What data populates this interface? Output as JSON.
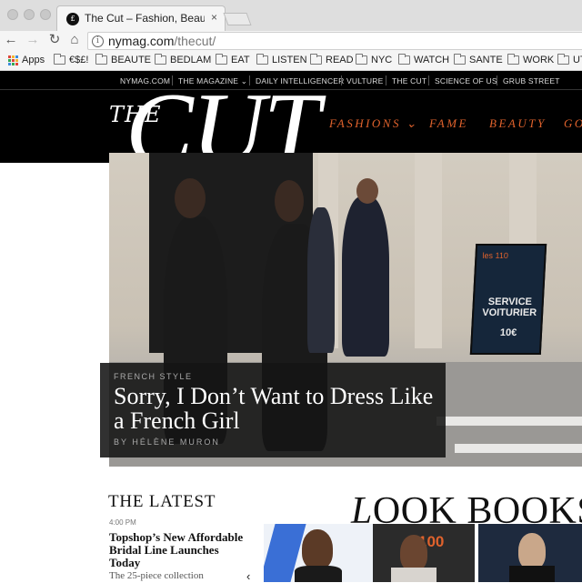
{
  "browser": {
    "tab_title": "The Cut – Fashion, Beauty, Politics",
    "tab_favicon": "£",
    "url_host": "nymag.com",
    "url_path": "/thecut/",
    "close_icon": "×"
  },
  "bookmarks": [
    "Apps",
    "€$£!",
    "BEAUTE",
    "BEDLAM",
    "EAT",
    "LISTEN",
    "READ",
    "NYC",
    "WATCH",
    "SANTE",
    "WORK",
    "UT"
  ],
  "site_nav": [
    "NYMAG.COM",
    "THE MAGAZINE ⌄",
    "DAILY INTELLIGENCER",
    "VULTURE",
    "THE CUT",
    "SCIENCE OF US",
    "GRUB STREET"
  ],
  "logo": {
    "the": "THE",
    "cut": "CUT"
  },
  "sections": [
    "FASHIONS ⌄",
    "FAME",
    "BEAUTY",
    "GO"
  ],
  "hero": {
    "kicker": "FRENCH STYLE",
    "headline": "Sorry, I Don’t Want to Dress Like a French Girl",
    "byline": "BY HÉLÈNE MURON",
    "sign_logo": "les 110",
    "sign_text": "SERVICE VOITURIER",
    "sign_price": "10€"
  },
  "latest": {
    "heading": "THE LATEST",
    "time": "4:00 PM",
    "title": "Topshop’s New Affordable Bridal Line Launches Today",
    "dek": "The 25-piece collection"
  },
  "lookbooks": {
    "heading_italic": "L",
    "heading_rest": "OOK BOOKS",
    "badge": "100",
    "arrow": "‹"
  },
  "colors": {
    "accent": "#e0622c",
    "header_bg": "#000000"
  }
}
